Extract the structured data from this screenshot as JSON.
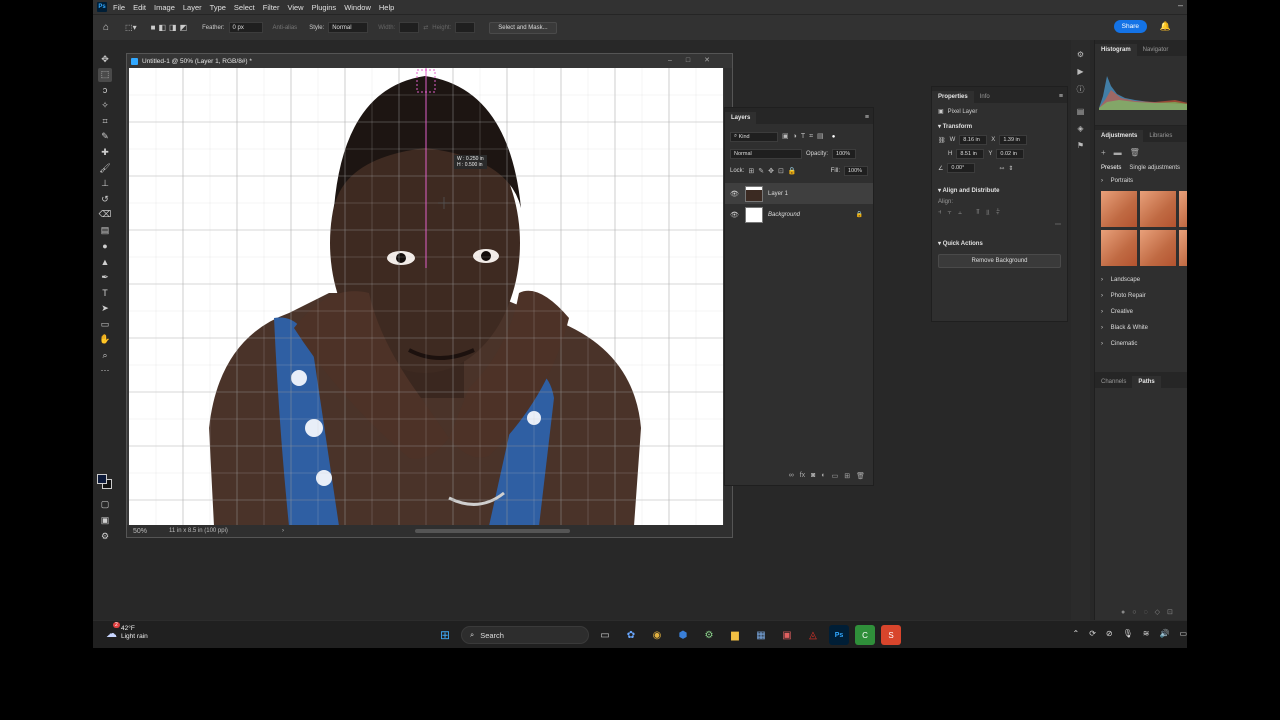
{
  "app": {
    "logo": "Ps",
    "menu": [
      "File",
      "Edit",
      "Image",
      "Layer",
      "Type",
      "Select",
      "Filter",
      "View",
      "Plugins",
      "Window",
      "Help"
    ]
  },
  "options": {
    "feather_label": "Feather:",
    "feather_value": "0 px",
    "anti_alias": "Anti-alias",
    "style_label": "Style:",
    "style_value": "Normal",
    "width_label": "Width:",
    "height_label": "Height:",
    "select_mask": "Select and Mask...",
    "share": "Share"
  },
  "document": {
    "title": "Untitled-1 @ 50% (Layer 1, RGB/8#) *",
    "zoom": "50%",
    "doc_info": "11 in x 8.5 in (100 ppi)",
    "tooltip_w": "W : 0.250 in",
    "tooltip_h": "H : 0.500 in"
  },
  "layers": {
    "tab": "Layers",
    "kind": "Kind",
    "blend": "Normal",
    "opacity_label": "Opacity:",
    "opacity": "100%",
    "lock_label": "Lock:",
    "fill_label": "Fill:",
    "fill": "100%",
    "items": [
      {
        "name": "Layer 1"
      },
      {
        "name": "Background"
      }
    ]
  },
  "properties": {
    "tab_properties": "Properties",
    "tab_info": "Info",
    "type": "Pixel Layer",
    "transform": "Transform",
    "w_label": "W",
    "w": "8.16 in",
    "h_label": "H",
    "h": "8.51 in",
    "x_label": "X",
    "x": "1.39 in",
    "y_label": "Y",
    "y": "0.02 in",
    "angle": "0.00°",
    "align_distribute": "Align and Distribute",
    "align": "Align:",
    "quick_actions": "Quick Actions",
    "remove_bg": "Remove Background"
  },
  "right_panels": {
    "histogram": "Histogram",
    "navigator": "Navigator",
    "adjustments": "Adjustments",
    "libraries": "Libraries",
    "presets": "Presets",
    "single": "Single adjustments",
    "portraits": "Portraits",
    "categories": [
      "Landscape",
      "Photo Repair",
      "Creative",
      "Black & White",
      "Cinematic"
    ],
    "channels": "Channels",
    "paths": "Paths"
  },
  "taskbar": {
    "temp": "42°F",
    "weather": "Light rain",
    "badge": "2",
    "search": "Search"
  }
}
